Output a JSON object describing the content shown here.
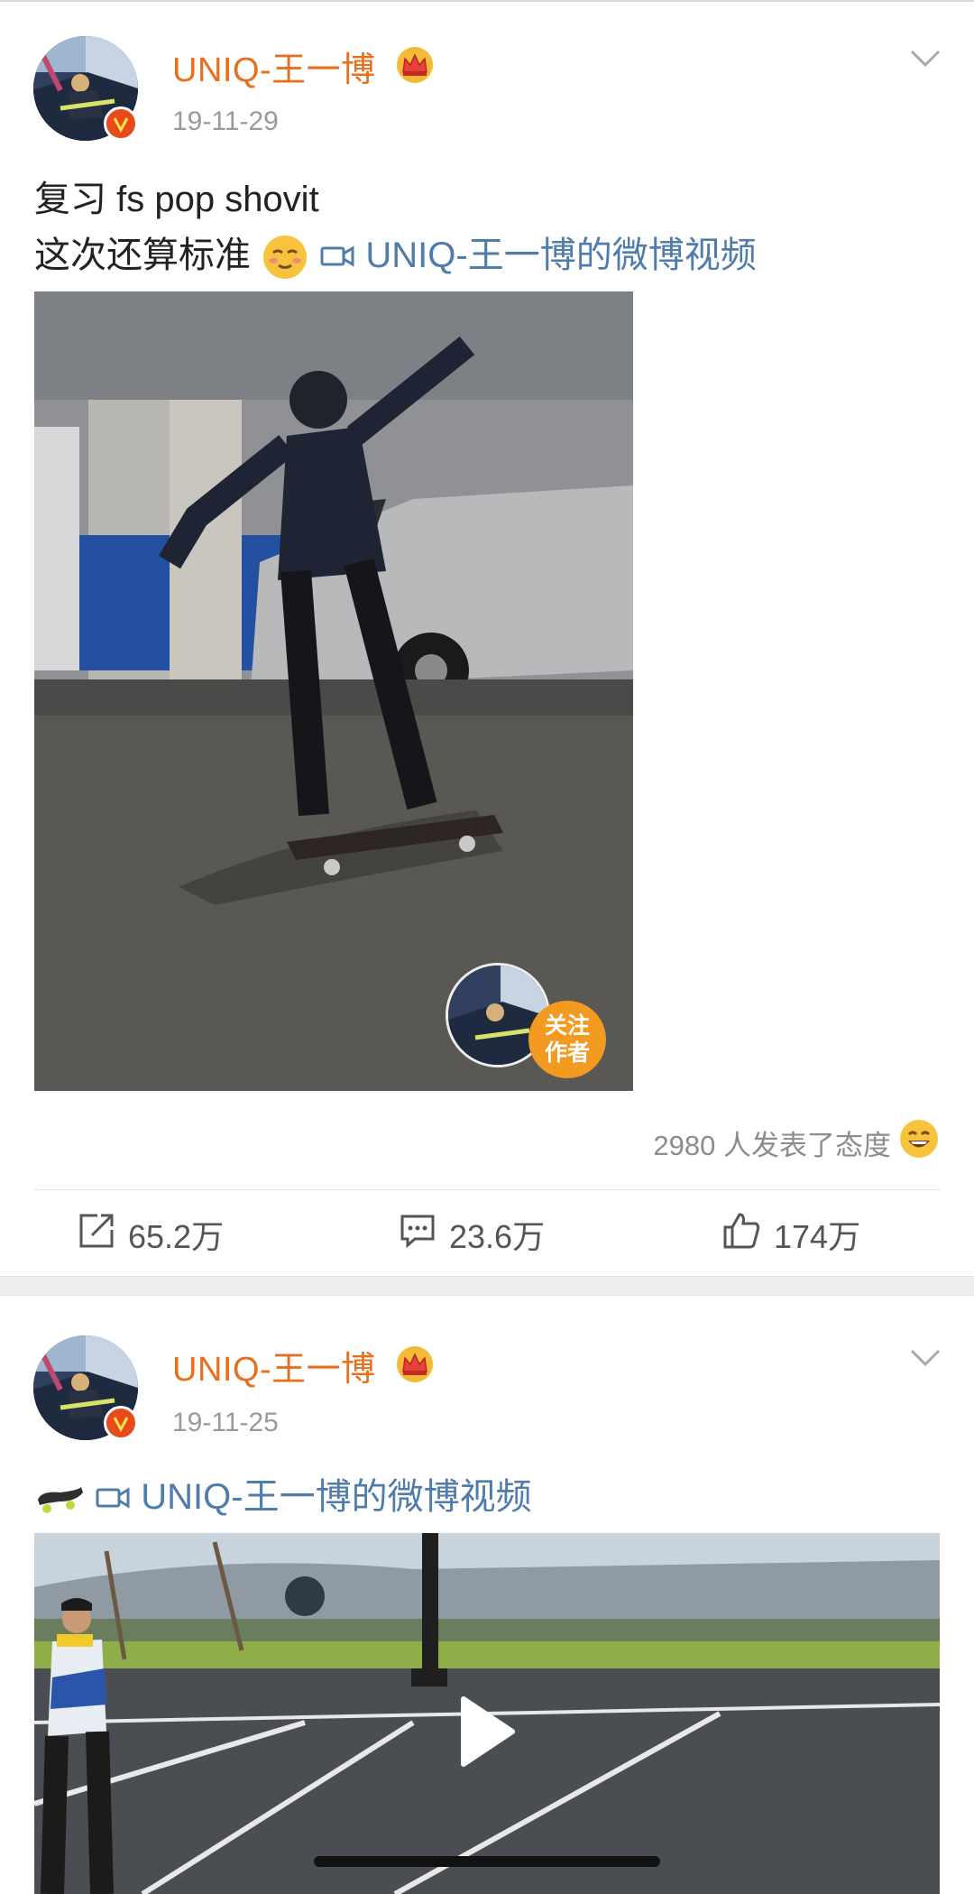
{
  "posts": [
    {
      "username": "UNIQ-王一博",
      "date": "19-11-29",
      "text_line1": "复习 fs pop shovit",
      "text_line2": "这次还算标准",
      "video_link": "UNIQ-王一博的微博视频",
      "follow_badge": {
        "line1": "关注",
        "line2": "作者"
      },
      "reactions": "2980 人发表了态度",
      "actions": {
        "repost": "65.2万",
        "comment": "23.6万",
        "like": "174万"
      }
    },
    {
      "username": "UNIQ-王一博",
      "date": "19-11-25",
      "video_link": "UNIQ-王一博的微博视频"
    }
  ],
  "colors": {
    "username": "#e86f1f",
    "link": "#4f7cab",
    "verified": "#e84a1b",
    "follow_badge": "#f39a21"
  },
  "icons": [
    "crown-icon",
    "verified-icon",
    "chevron-down-icon",
    "video-camera-icon",
    "repost-icon",
    "comment-icon",
    "like-icon",
    "play-icon",
    "skateboard-emoji",
    "smile-emoji"
  ]
}
